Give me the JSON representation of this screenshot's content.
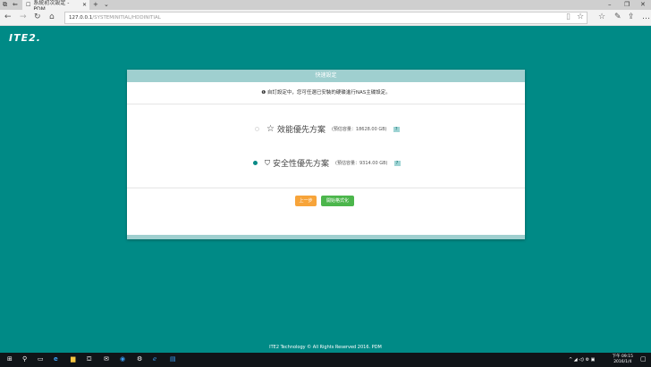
{
  "browser": {
    "tab_title": "系統初次設定 - PDM",
    "url_host": "127.0.0.1",
    "url_path": "/SYSTEMINITIAL/HDDINITIAL"
  },
  "logo": "ITE2.",
  "panel": {
    "title": "快速設定",
    "note": "自訂設定中，您可任選已安裝的硬碟進行NAS主碟設定。",
    "options": [
      {
        "label": "效能優先方案",
        "capacity": "(預估容量：18628.00 GB)",
        "selected": false,
        "icon": "star-icon"
      },
      {
        "label": "安全性優先方案",
        "capacity": "(預估容量：9314.00 GB)",
        "selected": true,
        "icon": "shield-icon"
      }
    ],
    "back": "上一步",
    "start": "開始格式化"
  },
  "footer": "ITE2 Technology © All Rights Reserved 2016. PDM",
  "taskbar": {
    "time": "下午 09:15",
    "date": "2016/1/4"
  }
}
